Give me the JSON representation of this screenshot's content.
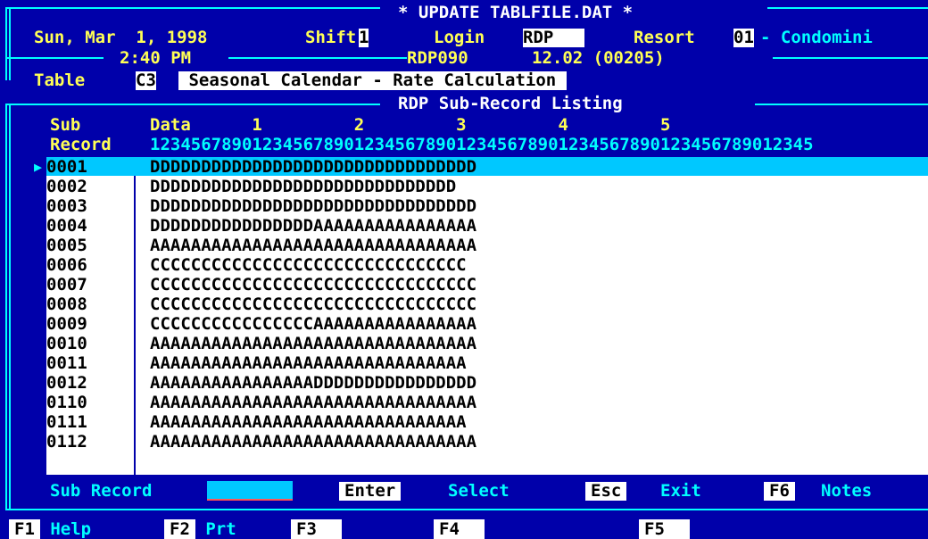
{
  "header": {
    "title": "* UPDATE TABLFILE.DAT *",
    "date": "Sun, Mar  1, 1998",
    "shift_label": "Shift",
    "shift_value": "1",
    "login_label": "Login",
    "login_value": "RDP   ",
    "resort_label": "Resort",
    "resort_value": "01",
    "resort_name": "- Condomini",
    "time": "2:40 PM",
    "terminal": "RDP090",
    "version": "12.02 (00205)"
  },
  "table": {
    "label": "Table",
    "code": "C3",
    "description": " Seasonal Calendar - Rate Calculation "
  },
  "listing": {
    "title": "RDP Sub-Record Listing",
    "col_sub_1": "Sub",
    "col_data_1": "Data",
    "ruler_tens": "          1         2         3         4         5",
    "col_sub_2": "Record",
    "ruler_units": "12345678901234567890123456789012345678901234567890123456789012345",
    "rows": [
      {
        "sub": "0001",
        "data": "DDDDDDDDDDDDDDDDDDDDDDDDDDDDDDDD"
      },
      {
        "sub": "0002",
        "data": "DDDDDDDDDDDDDDDDDDDDDDDDDDDDDD"
      },
      {
        "sub": "0003",
        "data": "DDDDDDDDDDDDDDDDDDDDDDDDDDDDDDDD"
      },
      {
        "sub": "0004",
        "data": "DDDDDDDDDDDDDDDDAAAAAAAAAAAAAAAA"
      },
      {
        "sub": "0005",
        "data": "AAAAAAAAAAAAAAAAAAAAAAAAAAAAAAAA"
      },
      {
        "sub": "0006",
        "data": "CCCCCCCCCCCCCCCCCCCCCCCCCCCCCCC"
      },
      {
        "sub": "0007",
        "data": "CCCCCCCCCCCCCCCCCCCCCCCCCCCCCCCC"
      },
      {
        "sub": "0008",
        "data": "CCCCCCCCCCCCCCCCCCCCCCCCCCCCCCCC"
      },
      {
        "sub": "0009",
        "data": "CCCCCCCCCCCCCCCCAAAAAAAAAAAAAAAA"
      },
      {
        "sub": "0010",
        "data": "AAAAAAAAAAAAAAAAAAAAAAAAAAAAAAAA"
      },
      {
        "sub": "0011",
        "data": "AAAAAAAAAAAAAAAAAAAAAAAAAAAAAAA"
      },
      {
        "sub": "0012",
        "data": "AAAAAAAAAAAAAAAADDDDDDDDDDDDDDDD"
      },
      {
        "sub": "0110",
        "data": "AAAAAAAAAAAAAAAAAAAAAAAAAAAAAAAA"
      },
      {
        "sub": "0111",
        "data": "AAAAAAAAAAAAAAAAAAAAAAAAAAAAAAA"
      },
      {
        "sub": "0112",
        "data": "AAAAAAAAAAAAAAAAAAAAAAAAAAAAAAAA"
      }
    ],
    "selected_index": 0
  },
  "footer": {
    "sub_record_label": "Sub Record",
    "sub_record_value": "",
    "enter_key": "Enter",
    "enter_label": "Select",
    "esc_key": "Esc",
    "esc_label": "Exit",
    "f6_key": "F6",
    "f6_label": "Notes"
  },
  "fkeys": [
    {
      "key": "F1",
      "label": "Help"
    },
    {
      "key": "F2",
      "label": "Prt"
    },
    {
      "key": "F3",
      "label": ""
    },
    {
      "key": "F4",
      "label": ""
    },
    {
      "key": "F5",
      "label": ""
    }
  ],
  "colors": {
    "background": "#0000aa",
    "accent": "#00ffff",
    "highlight": "#00c8ff",
    "label": "#ffff55"
  }
}
